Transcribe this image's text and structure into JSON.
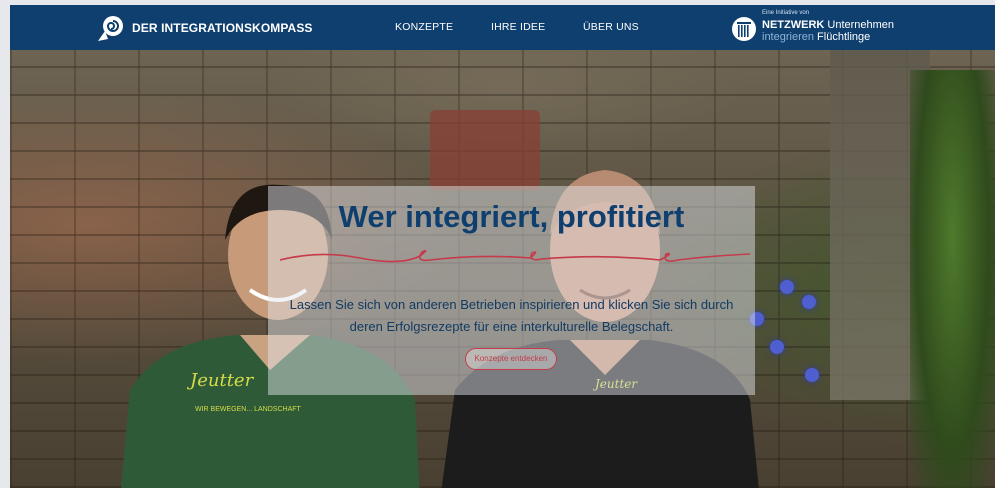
{
  "header": {
    "brand": "DER INTEGRATIONSKOMPASS",
    "nav": [
      {
        "label": "KONZEPTE"
      },
      {
        "label": "IHRE IDEE"
      },
      {
        "label": "ÜBER UNS"
      }
    ],
    "partner": {
      "kicker": "Eine Initiative von",
      "line1_bold": "NETZWERK",
      "line1_rest": "Unternehmen",
      "line2_light": "integrieren",
      "line2_rest": "Flüchtlinge"
    }
  },
  "hero": {
    "headline": "Wer integriert, profitiert",
    "body": "Lassen Sie sich von anderen Betrieben inspirieren und klicken Sie sich durch deren Erfolgsrezepte für eine interkulturelle Belegschaft.",
    "cta_label": "Konzepte entdecken",
    "shirt_left_logo": "Jeutter",
    "shirt_left_tagline": "WIR BEWEGEN... LANDSCHAFT",
    "shirt_right_logo": "Jeutter"
  },
  "colors": {
    "navbar": "#0f3f6e",
    "headline": "#0f3f6e",
    "accent": "#c63a4a"
  },
  "icons": {
    "brand_logo": "compass-swirl-icon",
    "partner_emblem": "building-columns-icon"
  }
}
